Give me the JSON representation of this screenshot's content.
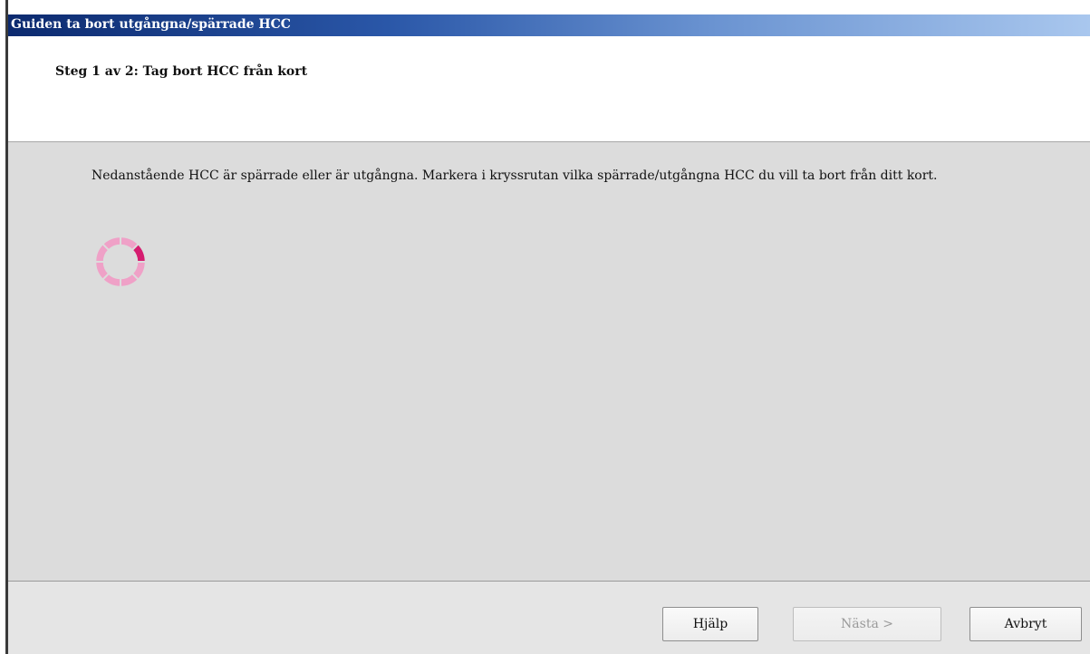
{
  "window": {
    "title": "Guiden ta bort utgångna/spärrade HCC"
  },
  "header": {
    "step_title": "Steg 1 av 2: Tag bort HCC från kort"
  },
  "content": {
    "description": "Nedanstående HCC är spärrade eller är utgångna. Markera i kryssrutan vilka spärrade/utgångna HCC du vill ta bort från ditt kort.",
    "loading_icon": "spinner-icon"
  },
  "footer": {
    "help_label": "Hjälp",
    "next_label": "Nästa >",
    "cancel_label": "Avbryt"
  },
  "colors": {
    "titlebar_start": "#0c2a6f",
    "titlebar_end": "#a9c7ee",
    "spinner_light": "#efa1c7",
    "spinner_active": "#d51c6f",
    "content_bg": "#dcdcdc"
  }
}
